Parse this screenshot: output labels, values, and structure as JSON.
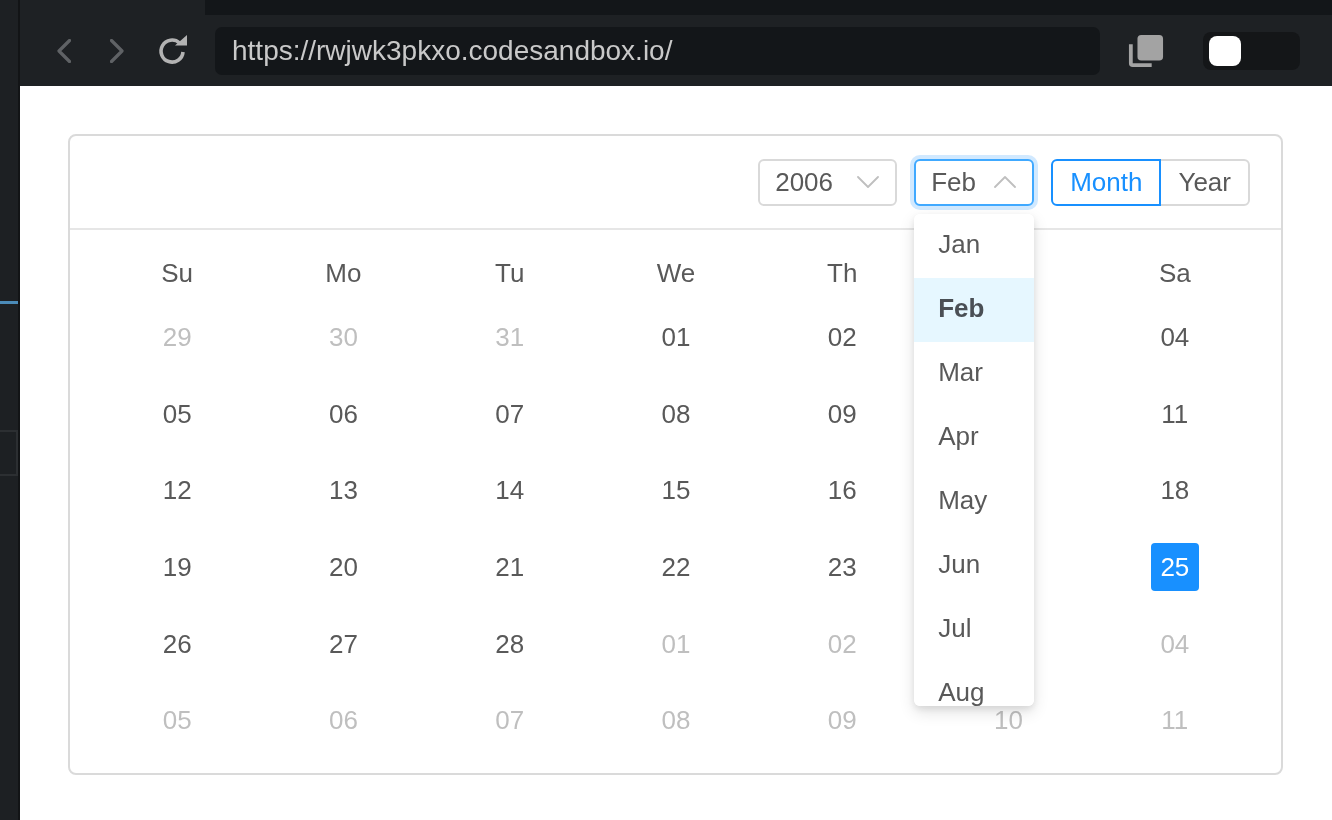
{
  "browser": {
    "url": "https://rwjwk3pkxo.codesandbox.io/",
    "toggle": {
      "on": false
    }
  },
  "calendar": {
    "year_select": {
      "value": "2006",
      "expanded": false
    },
    "month_select": {
      "value": "Feb",
      "expanded": true,
      "options": [
        {
          "label": "Jan",
          "selected": false
        },
        {
          "label": "Feb",
          "selected": true
        },
        {
          "label": "Mar",
          "selected": false
        },
        {
          "label": "Apr",
          "selected": false
        },
        {
          "label": "May",
          "selected": false
        },
        {
          "label": "Jun",
          "selected": false
        },
        {
          "label": "Jul",
          "selected": false
        },
        {
          "label": "Aug",
          "selected": false
        }
      ]
    },
    "mode": [
      {
        "label": "Month",
        "selected": true
      },
      {
        "label": "Year",
        "selected": false
      }
    ],
    "weekdays": {
      "su": "Su",
      "mo": "Mo",
      "tu": "Tu",
      "we": "We",
      "th": "Th",
      "sa": "Sa"
    },
    "weeks": [
      {
        "su": {
          "day": "29",
          "in_month": false,
          "selected": false
        },
        "mo": {
          "day": "30",
          "in_month": false,
          "selected": false
        },
        "tu": {
          "day": "31",
          "in_month": false,
          "selected": false
        },
        "we": {
          "day": "01",
          "in_month": true,
          "selected": false
        },
        "th": {
          "day": "02",
          "in_month": true,
          "selected": false
        },
        "sa": {
          "day": "04",
          "in_month": true,
          "selected": false
        }
      },
      {
        "su": {
          "day": "05",
          "in_month": true,
          "selected": false
        },
        "mo": {
          "day": "06",
          "in_month": true,
          "selected": false
        },
        "tu": {
          "day": "07",
          "in_month": true,
          "selected": false
        },
        "we": {
          "day": "08",
          "in_month": true,
          "selected": false
        },
        "th": {
          "day": "09",
          "in_month": true,
          "selected": false
        },
        "sa": {
          "day": "11",
          "in_month": true,
          "selected": false
        }
      },
      {
        "su": {
          "day": "12",
          "in_month": true,
          "selected": false
        },
        "mo": {
          "day": "13",
          "in_month": true,
          "selected": false
        },
        "tu": {
          "day": "14",
          "in_month": true,
          "selected": false
        },
        "we": {
          "day": "15",
          "in_month": true,
          "selected": false
        },
        "th": {
          "day": "16",
          "in_month": true,
          "selected": false
        },
        "sa": {
          "day": "18",
          "in_month": true,
          "selected": false
        }
      },
      {
        "su": {
          "day": "19",
          "in_month": true,
          "selected": false
        },
        "mo": {
          "day": "20",
          "in_month": true,
          "selected": false
        },
        "tu": {
          "day": "21",
          "in_month": true,
          "selected": false
        },
        "we": {
          "day": "22",
          "in_month": true,
          "selected": false
        },
        "th": {
          "day": "23",
          "in_month": true,
          "selected": false
        },
        "sa": {
          "day": "25",
          "in_month": true,
          "selected": true
        }
      },
      {
        "su": {
          "day": "26",
          "in_month": true,
          "selected": false
        },
        "mo": {
          "day": "27",
          "in_month": true,
          "selected": false
        },
        "tu": {
          "day": "28",
          "in_month": true,
          "selected": false
        },
        "we": {
          "day": "01",
          "in_month": false,
          "selected": false
        },
        "th": {
          "day": "02",
          "in_month": false,
          "selected": false
        },
        "sa": {
          "day": "04",
          "in_month": false,
          "selected": false
        }
      },
      {
        "su": {
          "day": "05",
          "in_month": false,
          "selected": false
        },
        "mo": {
          "day": "06",
          "in_month": false,
          "selected": false
        },
        "tu": {
          "day": "07",
          "in_month": false,
          "selected": false
        },
        "we": {
          "day": "08",
          "in_month": false,
          "selected": false
        },
        "th": {
          "day": "09",
          "in_month": false,
          "selected": false
        },
        "fr": {
          "day": "10",
          "in_month": false,
          "selected": false
        },
        "sa": {
          "day": "11",
          "in_month": false,
          "selected": false
        }
      }
    ]
  }
}
